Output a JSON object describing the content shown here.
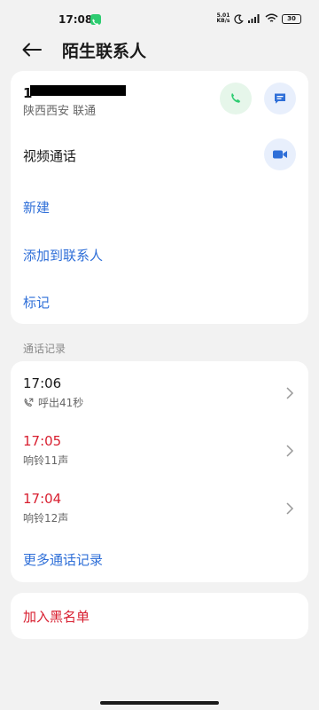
{
  "status_bar": {
    "time": "17:08",
    "net_speed_value": "5.01",
    "net_speed_unit": "KB/s",
    "battery": "30"
  },
  "header": {
    "title": "陌生联系人"
  },
  "contact": {
    "number_visible": "1",
    "location_carrier": "陕西西安 联通",
    "video_call_label": "视频通话",
    "actions": {
      "new": "新建",
      "add_to_contacts": "添加到联系人",
      "mark": "标记"
    }
  },
  "call_log": {
    "section_label": "通话记录",
    "entries": [
      {
        "time": "17:06",
        "detail": "呼出41秒",
        "type": "outgoing"
      },
      {
        "time": "17:05",
        "detail": "响铃11声",
        "type": "missed"
      },
      {
        "time": "17:04",
        "detail": "响铃12声",
        "type": "missed"
      }
    ],
    "more_label": "更多通话记录"
  },
  "block": {
    "label": "加入黑名单"
  },
  "colors": {
    "accent_blue": "#2f6fd8",
    "missed_red": "#d81e2f",
    "call_green": "#2ecc71",
    "background": "#f2f2f2"
  }
}
